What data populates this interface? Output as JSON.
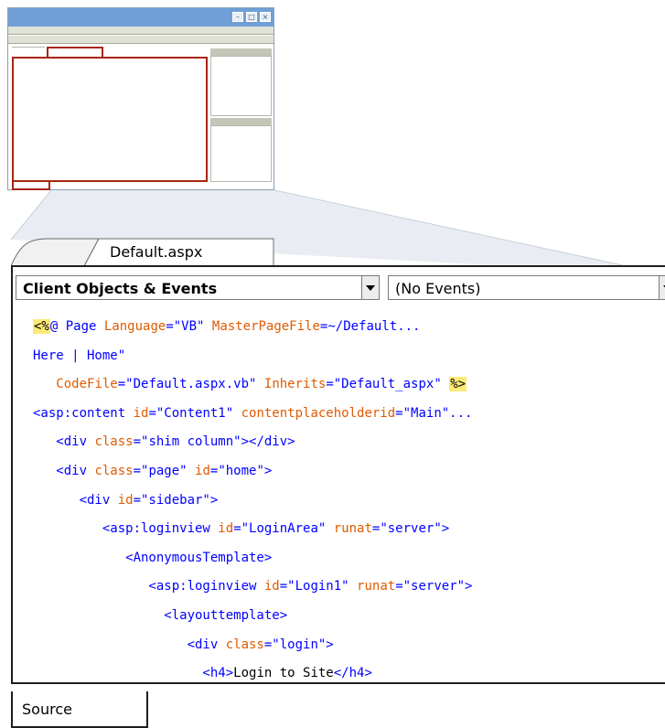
{
  "thumbnail": {
    "controls": [
      "minimize",
      "maximize",
      "close"
    ]
  },
  "document_tab": {
    "label": "Default.aspx"
  },
  "dropdowns": {
    "objects": {
      "value": "Client Objects & Events"
    },
    "events": {
      "value": "(No Events)"
    }
  },
  "code_lines": [
    [
      {
        "c": "hl",
        "t": "<%"
      },
      {
        "c": "v",
        "t": "@ Page "
      },
      {
        "c": "a",
        "t": "Language"
      },
      {
        "c": "v",
        "t": "=\"VB\" "
      },
      {
        "c": "a",
        "t": "MasterPageFile"
      },
      {
        "c": "v",
        "t": "=~/Default..."
      }
    ],
    [
      {
        "c": "v",
        "t": "Here | Home\""
      }
    ],
    [
      {
        "c": "v",
        "t": "   "
      },
      {
        "c": "a",
        "t": "CodeFile"
      },
      {
        "c": "v",
        "t": "=\"Default.aspx.vb\" "
      },
      {
        "c": "a",
        "t": "Inherits"
      },
      {
        "c": "v",
        "t": "=\"Default_aspx\" "
      },
      {
        "c": "hl",
        "t": "%>"
      }
    ],
    [
      {
        "c": "v",
        "t": "<asp:content "
      },
      {
        "c": "a",
        "t": "id"
      },
      {
        "c": "v",
        "t": "=\"Content1\" "
      },
      {
        "c": "a",
        "t": "contentplaceholderid"
      },
      {
        "c": "v",
        "t": "=\"Main\"..."
      }
    ],
    [
      {
        "c": "v",
        "t": "   <div "
      },
      {
        "c": "a",
        "t": "class"
      },
      {
        "c": "v",
        "t": "=\"shim column\"></div>"
      }
    ],
    [
      {
        "c": "v",
        "t": "   <div "
      },
      {
        "c": "a",
        "t": "class"
      },
      {
        "c": "v",
        "t": "=\"page\" "
      },
      {
        "c": "a",
        "t": "id"
      },
      {
        "c": "v",
        "t": "=\"home\">"
      }
    ],
    [
      {
        "c": "v",
        "t": "      <div "
      },
      {
        "c": "a",
        "t": "id"
      },
      {
        "c": "v",
        "t": "=\"sidebar\">"
      }
    ],
    [
      {
        "c": "v",
        "t": "         <asp:loginview "
      },
      {
        "c": "a",
        "t": "id"
      },
      {
        "c": "v",
        "t": "=\"LoginArea\" "
      },
      {
        "c": "a",
        "t": "runat"
      },
      {
        "c": "v",
        "t": "=\"server\">"
      }
    ],
    [
      {
        "c": "v",
        "t": "            <AnonymousTemplate>"
      }
    ],
    [
      {
        "c": "v",
        "t": "               <asp:loginview "
      },
      {
        "c": "a",
        "t": "id"
      },
      {
        "c": "v",
        "t": "=\"Login1\" "
      },
      {
        "c": "a",
        "t": "runat"
      },
      {
        "c": "v",
        "t": "=\"server\">"
      }
    ],
    [
      {
        "c": "v",
        "t": "                 <layouttemplate>"
      }
    ],
    [
      {
        "c": "v",
        "t": "                    <div "
      },
      {
        "c": "a",
        "t": "class"
      },
      {
        "c": "v",
        "t": "=\"login\">"
      }
    ],
    [
      {
        "c": "v",
        "t": "                      <h4>"
      },
      {
        "c": "t",
        "t": "Login to Site"
      },
      {
        "c": "v",
        "t": "</h4>"
      }
    ]
  ],
  "bottom_tab": {
    "label": "Source"
  },
  "colors": {
    "highlight": "#fde978",
    "tag": "#0000ff",
    "attribute": "#e05a00",
    "thumbnail_accent": "#a8250f",
    "titlebar": "#6f9fd6"
  }
}
